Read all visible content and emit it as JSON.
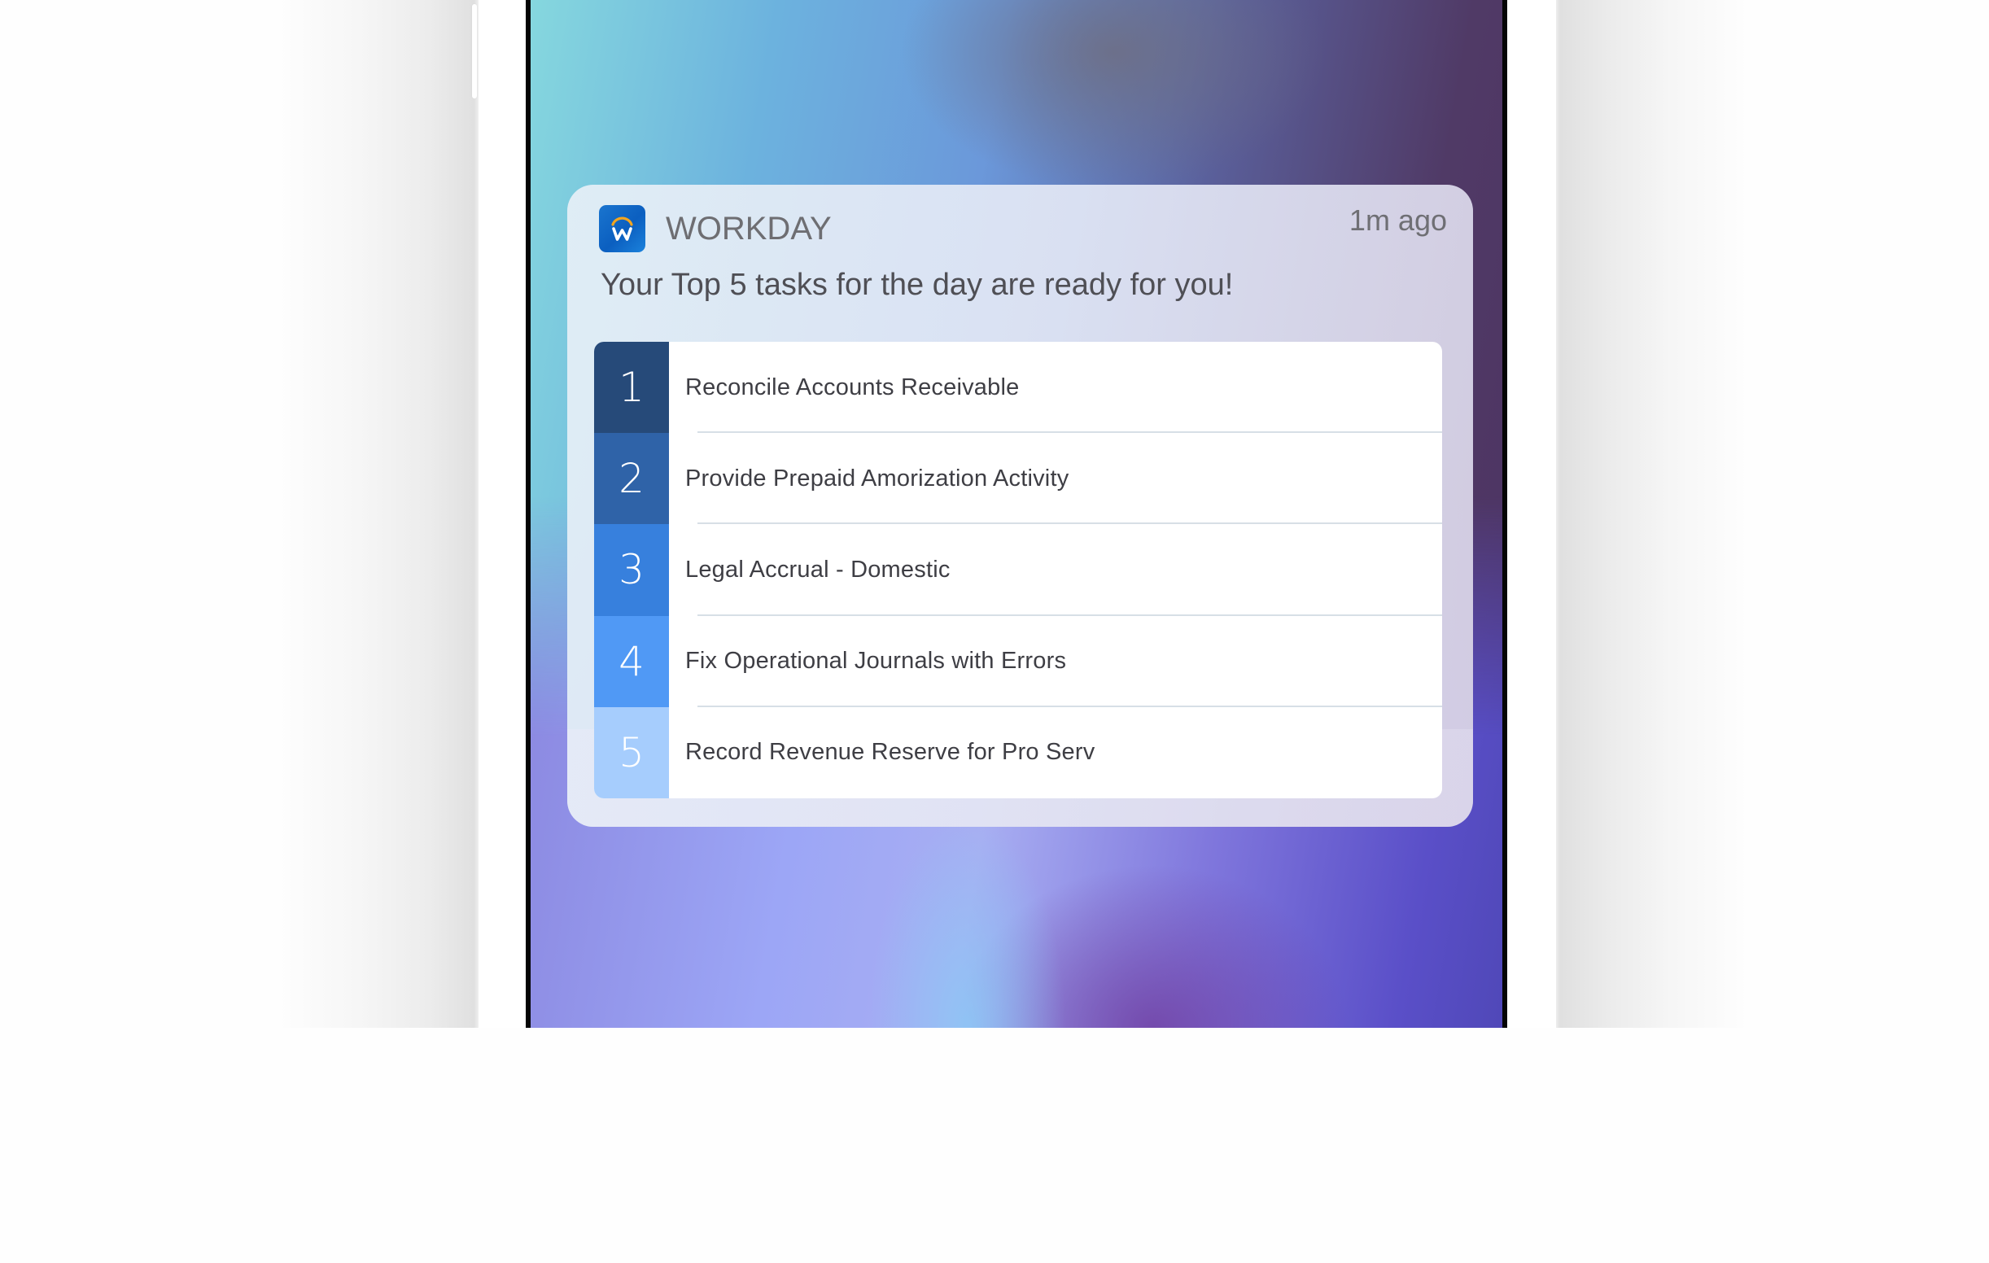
{
  "notification": {
    "app_name": "WORKDAY",
    "app_icon": "workday-logo-icon",
    "timestamp": "1m ago",
    "message": "Your Top 5 tasks for the day are ready for you!",
    "tasks": [
      {
        "number": "1",
        "label": "Reconcile Accounts Receivable",
        "color": "#264a79"
      },
      {
        "number": "2",
        "label": "Provide Prepaid Amorization Activity",
        "color": "#2f63a8"
      },
      {
        "number": "3",
        "label": "Legal Accrual - Domestic",
        "color": "#3780dd"
      },
      {
        "number": "4",
        "label": "Fix Operational Journals with Errors",
        "color": "#5099f5"
      },
      {
        "number": "5",
        "label": "Record Revenue Reserve for Pro Serv",
        "color": "#a6cdfd"
      }
    ]
  },
  "colors": {
    "brand_blue": "#0b5fc0",
    "brand_orange": "#f2a51f"
  }
}
